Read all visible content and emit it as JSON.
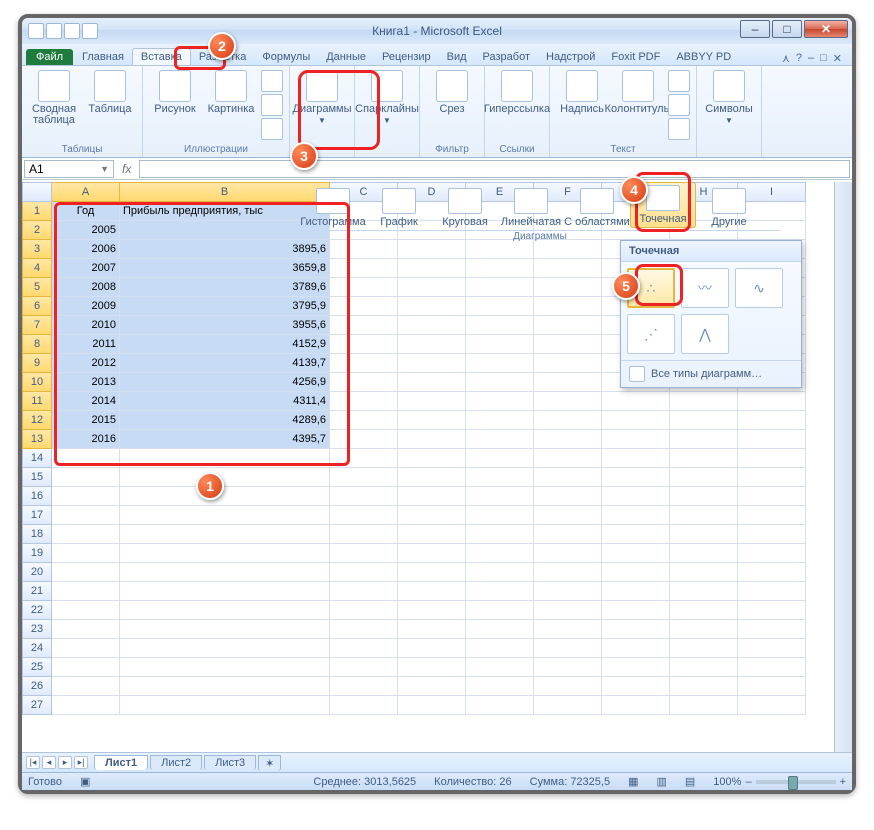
{
  "window": {
    "title": "Книга1 - Microsoft Excel"
  },
  "tabs": {
    "file": "Файл",
    "items": [
      "Главная",
      "Вставка",
      "Разметка",
      "Формулы",
      "Данные",
      "Рецензир",
      "Вид",
      "Разработ",
      "Надстрой",
      "Foxit PDF",
      "ABBYY PD"
    ],
    "active_index": 1
  },
  "ribbon": {
    "tables": {
      "pivot": "Сводная таблица",
      "table": "Таблица",
      "label": "Таблицы"
    },
    "illus": {
      "picture": "Рисунок",
      "clipart": "Картинка",
      "label": "Иллюстрации"
    },
    "charts": {
      "button": "Диаграммы"
    },
    "spark": {
      "button": "Спарклайны"
    },
    "filter": {
      "button": "Срез",
      "label": "Фильтр"
    },
    "links": {
      "button": "Гиперссылка",
      "label": "Ссылки"
    },
    "text": {
      "textbox": "Надпись",
      "header": "Колонтитулы",
      "label": "Текст"
    },
    "symbols": {
      "button": "Символы"
    }
  },
  "chart_gallery": {
    "items": [
      "Гистограмма",
      "График",
      "Круговая",
      "Линейчатая",
      "С областями",
      "Точечная",
      "Другие"
    ],
    "active_index": 5,
    "group_label": "Диаграммы"
  },
  "scatter_popup": {
    "header": "Точечная",
    "all_charts": "Все типы диаграмм…"
  },
  "namebox": "A1",
  "cols": [
    "A",
    "B",
    "C",
    "D",
    "E",
    "F",
    "G",
    "H",
    "I"
  ],
  "data": {
    "headers": [
      "Год",
      "Прибыль предприятия, тыс"
    ],
    "rows": [
      [
        "2005",
        ""
      ],
      [
        "2006",
        "3895,6"
      ],
      [
        "2007",
        "3659,8"
      ],
      [
        "2008",
        "3789,6"
      ],
      [
        "2009",
        "3795,9"
      ],
      [
        "2010",
        "3955,6"
      ],
      [
        "2011",
        "4152,9"
      ],
      [
        "2012",
        "4139,7"
      ],
      [
        "2013",
        "4256,9"
      ],
      [
        "2014",
        "4311,4"
      ],
      [
        "2015",
        "4289,6"
      ],
      [
        "2016",
        "4395,7"
      ]
    ]
  },
  "sheet_tabs": [
    "Лист1",
    "Лист2",
    "Лист3"
  ],
  "status": {
    "ready": "Готово",
    "avg_label": "Среднее:",
    "avg": "3013,5625",
    "count_label": "Количество:",
    "count": "26",
    "sum_label": "Сумма:",
    "sum": "72325,5",
    "zoom": "100%"
  },
  "badges": {
    "b1": "1",
    "b2": "2",
    "b3": "3",
    "b4": "4",
    "b5": "5"
  }
}
